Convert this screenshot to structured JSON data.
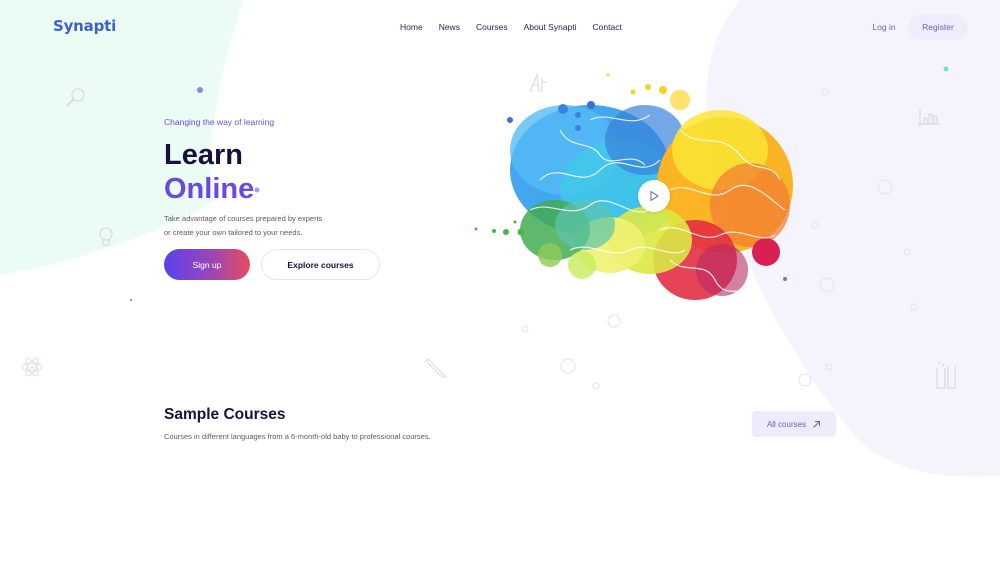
{
  "brand": {
    "name": "Synapti",
    "color": "#3d5fcf"
  },
  "nav": {
    "items": [
      {
        "label": "Home"
      },
      {
        "label": "News"
      },
      {
        "label": "Courses"
      },
      {
        "label": "About Synapti"
      },
      {
        "label": "Contact"
      }
    ],
    "login_label": "Log in",
    "register_label": "Register"
  },
  "hero": {
    "tagline": "Changing the way of learning",
    "title_line1": "Learn",
    "title_line2": "Online",
    "description_line1": "Take advantage of courses prepared by experts",
    "description_line2": "or create your own tailored to your needs.",
    "primary_button": "Sign up",
    "secondary_button": "Explore courses",
    "media_icon": "play-icon"
  },
  "sample_courses": {
    "title": "Sample Courses",
    "subtitle": "Courses in different languages from a 6-month-old baby to professional courses.",
    "all_courses_label": "All courses",
    "all_courses_icon": "arrow-up-right-icon"
  },
  "colors": {
    "accent": "#6a48e3",
    "heading": "#17123d",
    "mint_bg": "#eafcf5",
    "lavender_bg": "#f4f3fd",
    "gradient_start": "#5b42ea",
    "gradient_end": "#e84c5c"
  }
}
